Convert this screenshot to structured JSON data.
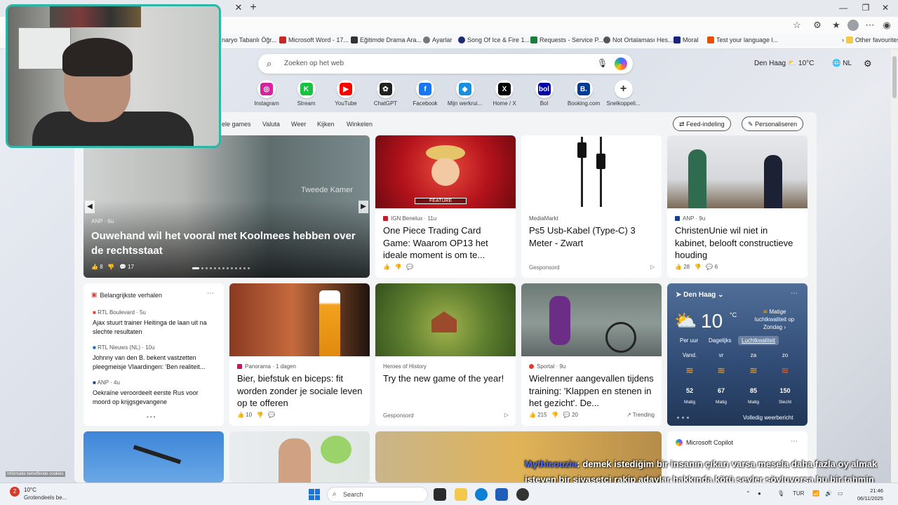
{
  "browser": {
    "favorites": [
      "naryo Tabanlı Öğr...",
      "Microsoft Word - 17...",
      "Eğitimde Drama Ara...",
      "Ayarlar",
      "Song Of Ice & Fire 1...",
      "Requests - Service P...",
      "Not Ortalaması Hes...",
      "Moral",
      "Test your language l...",
      "Other favourites"
    ]
  },
  "search": {
    "placeholder": "Zoeken op het web"
  },
  "header": {
    "location": "Den Haag",
    "temp": "10°C",
    "lang": "NL"
  },
  "shortcuts": [
    {
      "label": "Instagram",
      "icon": "instagram-icon",
      "color": "#d6249f",
      "glyph": "◎"
    },
    {
      "label": "Stream",
      "icon": "stream-icon",
      "color": "#18c241",
      "glyph": "K"
    },
    {
      "label": "YouTube",
      "icon": "youtube-icon",
      "color": "#ff0000",
      "glyph": "▶"
    },
    {
      "label": "ChatGPT",
      "icon": "chatgpt-icon",
      "color": "#222222",
      "glyph": "✿"
    },
    {
      "label": "Facebook",
      "icon": "facebook-icon",
      "color": "#1877f2",
      "glyph": "f"
    },
    {
      "label": "Mijn werkrui...",
      "icon": "workspace-icon",
      "color": "#1a8fe0",
      "glyph": "◆"
    },
    {
      "label": "Home / X",
      "icon": "x-icon",
      "color": "#000000",
      "glyph": "X"
    },
    {
      "label": "Bol",
      "icon": "bol-icon",
      "color": "#0000a4",
      "glyph": "bol"
    },
    {
      "label": "Booking.com",
      "icon": "booking-icon",
      "color": "#003b95",
      "glyph": "B."
    },
    {
      "label": "Snelkoppeli...",
      "icon": "add-shortcut-icon",
      "color": "#ffffff",
      "glyph": "+"
    }
  ],
  "feed_nav": {
    "items": [
      "ele games",
      "Valuta",
      "Weer",
      "Kijken",
      "Winkelen"
    ],
    "feed_layout": "Feed-indeling",
    "personalize": "Personaliseren"
  },
  "hero": {
    "source": "ANP · 6u",
    "title": "Ouwehand wil het vooral met Koolmees hebben over de rechtsstaat",
    "likes": "8",
    "comments": "17",
    "watermark": "Tweede Kamer"
  },
  "cards": {
    "onepiece": {
      "source": "IGN Benelux · 11u",
      "badge": "FEATURE",
      "title": "One Piece Trading Card Game: Waarom OP13 het ideale moment is om te..."
    },
    "cable": {
      "source": "MediaMarkt",
      "title": "Ps5 Usb-Kabel (Type-C) 3 Meter - Zwart",
      "sponsored": "Gesponsord"
    },
    "christenunie": {
      "source": "ANP · 9u",
      "title": "ChristenUnie wil niet in kabinet, belooft constructieve houding",
      "likes": "28",
      "comments": "6"
    },
    "beer": {
      "source": "Panorama · 1 dagen",
      "title": "Bier, biefstuk en biceps: fit worden zonder je sociale leven op te offeren",
      "likes": "10"
    },
    "game": {
      "source": "Heroes of History",
      "title": "Try the new game of the year!",
      "sponsored": "Gesponsord"
    },
    "cycling": {
      "source": "Sportal · 9u",
      "title": "Wielrenner aangevallen tijdens training: 'Klappen en stenen in het gezicht'. De...",
      "likes": "215",
      "comments": "20",
      "trending": "Trending"
    }
  },
  "top_stories": {
    "header": "Belangrijkste verhalen",
    "items": [
      {
        "source": "RTL Boulevard · 5u",
        "title": "Ajax stuurt trainer Heitinga de laan uit na slechte resultaten"
      },
      {
        "source": "RTL Nieuws (NL) · 10u",
        "title": "Johnny van den B. bekent vastzetten pleegmeisje Vlaardingen: 'Ben realiteit..."
      },
      {
        "source": "ANP · 4u",
        "title": "Oekraïne veroordeelt eerste Rus voor moord op krijgsgevangene"
      }
    ]
  },
  "weather": {
    "location": "Den Haag",
    "temp": "10",
    "unit": "°C",
    "air_quality": "Matige luchtkwaliteit op Zondag",
    "tabs": [
      "Per uur",
      "Dagelijks",
      "Luchtkwaliteit"
    ],
    "days": [
      {
        "day": "Vand.",
        "value": "52",
        "label": "Matig"
      },
      {
        "day": "vr",
        "value": "67",
        "label": "Matig"
      },
      {
        "day": "za",
        "value": "85",
        "label": "Matig"
      },
      {
        "day": "zo",
        "value": "150",
        "label": "Slecht"
      }
    ],
    "full_link": "Volledig weerbericht"
  },
  "copilot": {
    "title": "Microsoft Copilot"
  },
  "cookies": "Informatie betreffende cookies",
  "chat": {
    "user": "Mythicouzia",
    "message": ": demek istediğim bir insanın çıkarı varsa mesela daha fazla oy almak isteyen bir siyasetçi rakip adaylar hakkında kötü şeyler söyluyorsa bu bir tahmin oluşturmaz mı?"
  },
  "taskbar": {
    "weather_temp": "10°C",
    "weather_desc": "Grotendeels be...",
    "weather_badge": "2",
    "search": "Search",
    "lang": "TUR",
    "time": "21:46",
    "date": "06/11/2025"
  }
}
